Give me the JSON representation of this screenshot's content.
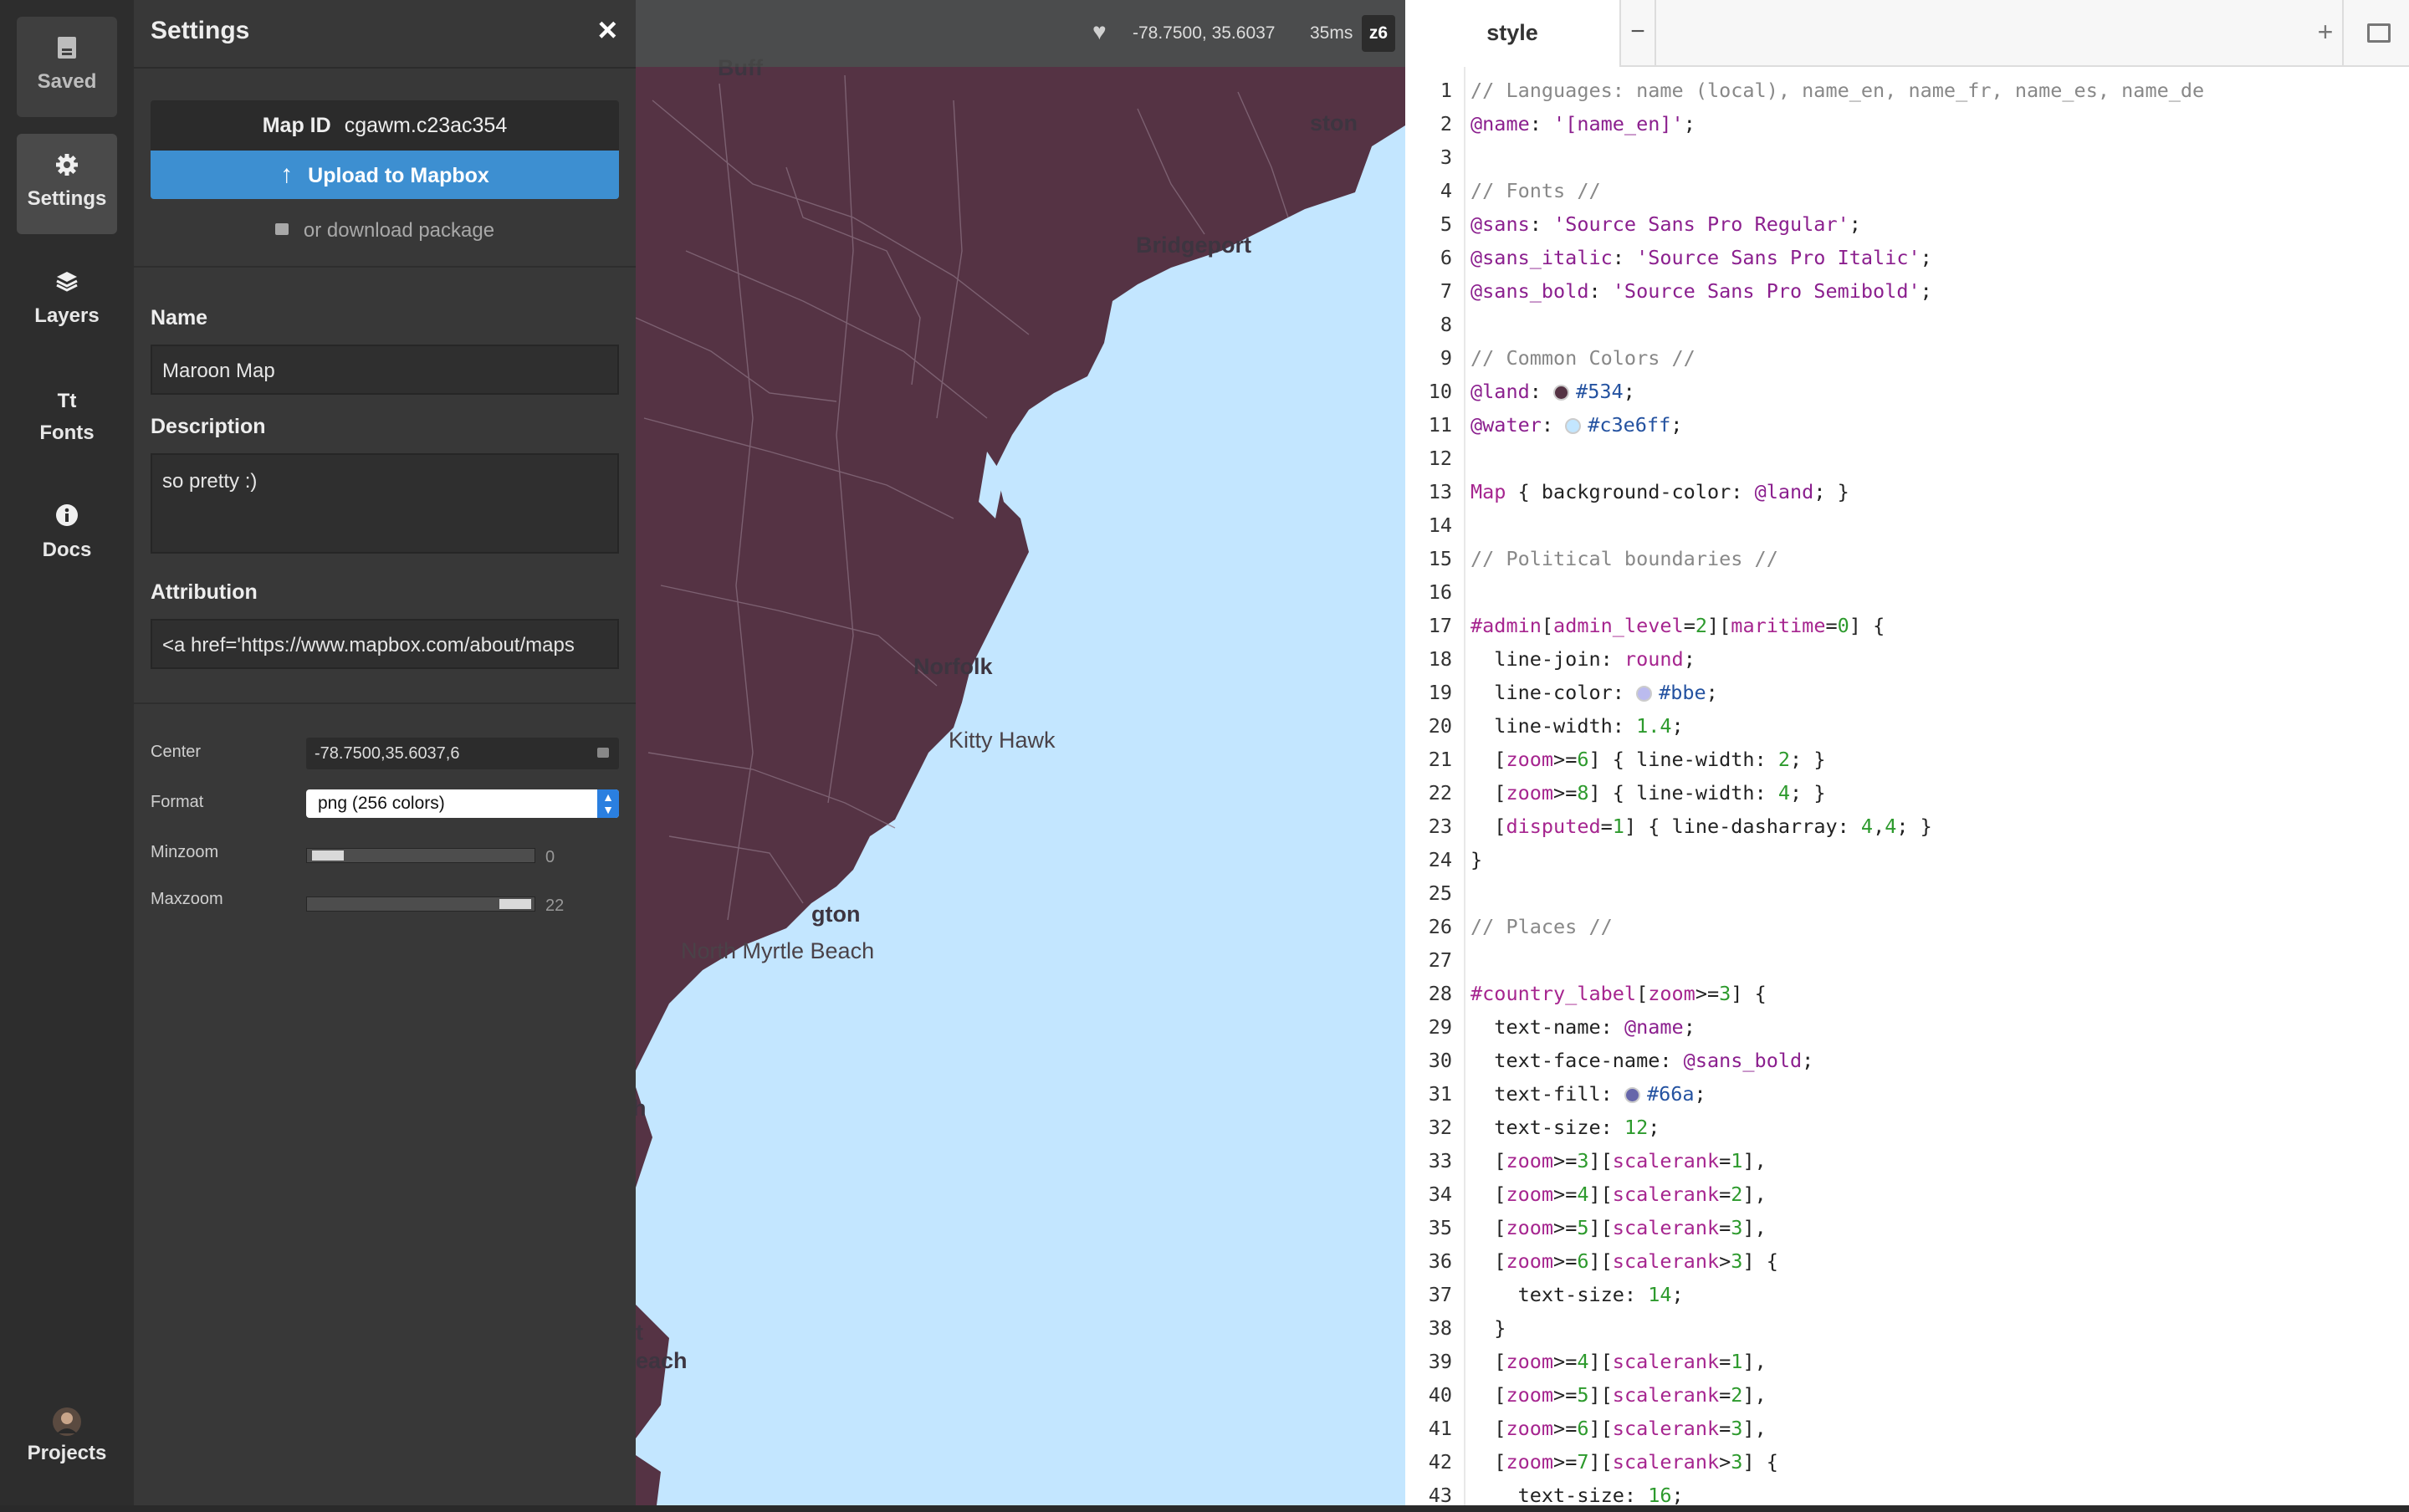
{
  "nav": {
    "items": [
      {
        "label": "Saved",
        "icon": "save-icon"
      },
      {
        "label": "Settings",
        "icon": "gear-icon"
      },
      {
        "label": "Layers",
        "icon": "layers-icon"
      },
      {
        "label": "Fonts",
        "icon": "fonts-icon"
      },
      {
        "label": "Docs",
        "icon": "info-icon"
      },
      {
        "label": "Projects",
        "icon": "avatar-icon"
      }
    ]
  },
  "settings": {
    "title": "Settings",
    "close": "×",
    "map_id_label": "Map ID",
    "map_id": "cgawm.c23ac354",
    "upload_label": "Upload to Mapbox",
    "download_label": "or download package",
    "name_label": "Name",
    "name_value": "Maroon Map",
    "description_label": "Description",
    "description_value": "so pretty :)",
    "attribution_label": "Attribution",
    "attribution_value": "<a href='https://www.mapbox.com/about/maps",
    "center_label": "Center",
    "center_value": "-78.7500,35.6037,6",
    "format_label": "Format",
    "format_value": "png (256 colors)",
    "minzoom_label": "Minzoom",
    "minzoom_value": "0",
    "maxzoom_label": "Maxzoom",
    "maxzoom_value": "22"
  },
  "map": {
    "coords": "-78.7500, 35.6037",
    "render_time": "35ms",
    "zoom": "z6",
    "land_color": "#534",
    "water_color": "#c3e6ff",
    "labels": [
      "Bridgeport",
      "Kitty Hawk",
      "North Myrtle Beach",
      "Norfolk",
      "gton",
      "Buff",
      "ston",
      "t",
      "each",
      "h"
    ]
  },
  "editor": {
    "tab_label": "style",
    "minus": "−",
    "plus": "+",
    "lines": [
      "// Languages: name (local), name_en, name_fr, name_es, name_de",
      "@name: '[name_en]';",
      "",
      "// Fonts //",
      "@sans: 'Source Sans Pro Regular';",
      "@sans_italic: 'Source Sans Pro Italic';",
      "@sans_bold: 'Source Sans Pro Semibold';",
      "",
      "// Common Colors //",
      "@land: #534;",
      "@water: #c3e6ff;",
      "",
      "Map { background-color: @land; }",
      "",
      "// Political boundaries //",
      "",
      "#admin[admin_level=2][maritime=0] {",
      "  line-join: round;",
      "  line-color: #bbe;",
      "  line-width: 1.4;",
      "  [zoom>=6] { line-width: 2; }",
      "  [zoom>=8] { line-width: 4; }",
      "  [disputed=1] { line-dasharray: 4,4; }",
      "}",
      "",
      "// Places //",
      "",
      "#country_label[zoom>=3] {",
      "  text-name: @name;",
      "  text-face-name: @sans_bold;",
      "  text-fill: #66a;",
      "  text-size: 12;",
      "  [zoom>=3][scalerank=1],",
      "  [zoom>=4][scalerank=2],",
      "  [zoom>=5][scalerank=3],",
      "  [zoom>=6][scalerank>3] {",
      "    text-size: 14;",
      "  }",
      "  [zoom>=4][scalerank=1],",
      "  [zoom>=5][scalerank=2],",
      "  [zoom>=6][scalerank=3],",
      "  [zoom>=7][scalerank>3] {",
      "    text-size: 16;"
    ]
  }
}
